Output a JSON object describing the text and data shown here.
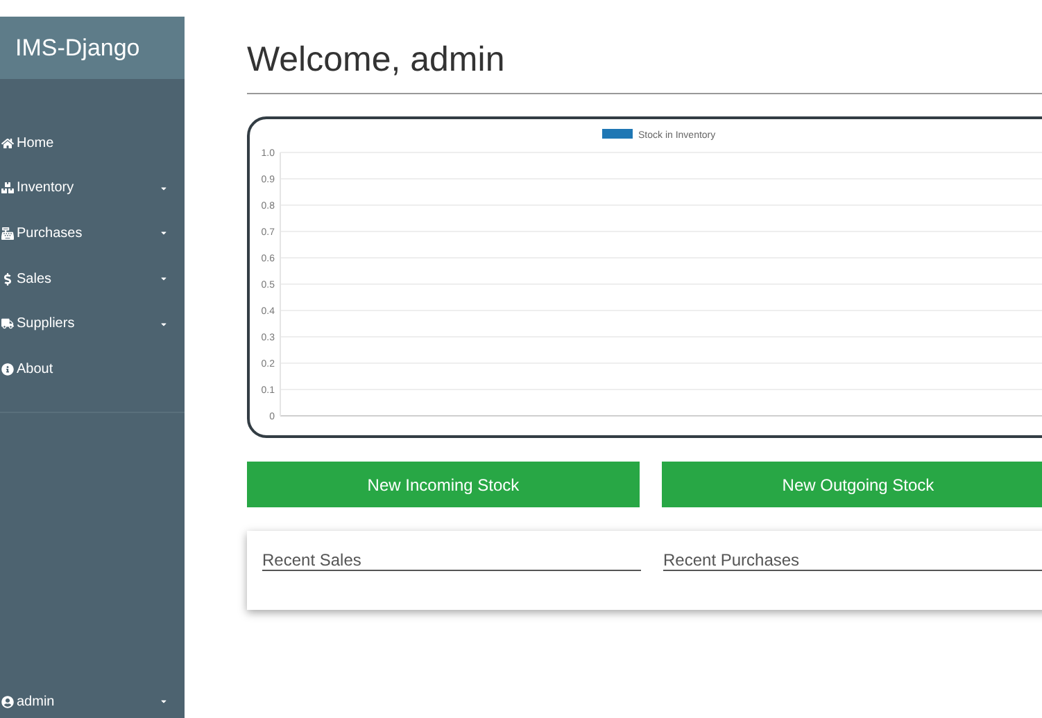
{
  "sidebar": {
    "brand": "IMS-Django",
    "items": [
      {
        "label": "Home",
        "dropdown": false
      },
      {
        "label": "Inventory",
        "dropdown": true
      },
      {
        "label": "Purchases",
        "dropdown": true
      },
      {
        "label": "Sales",
        "dropdown": true
      },
      {
        "label": "Suppliers",
        "dropdown": true
      },
      {
        "label": "About",
        "dropdown": false
      }
    ],
    "user": {
      "label": "admin",
      "dropdown": true
    }
  },
  "main": {
    "title": "Welcome, admin",
    "chart": {
      "chart_data": {
        "type": "bar",
        "grid": true,
        "series": [
          {
            "name": "Stock in Inventory",
            "color": "#1f77b4"
          }
        ],
        "ylim": [
          0,
          1
        ],
        "yticks": [
          {
            "value": 0,
            "label": "0"
          },
          {
            "value": 0.1,
            "label": "0.1"
          },
          {
            "value": 0.2,
            "label": "0.2"
          },
          {
            "value": 0.3,
            "label": "0.3"
          },
          {
            "value": 0.4,
            "label": "0.4"
          },
          {
            "value": 0.5,
            "label": "0.5"
          },
          {
            "value": 0.6,
            "label": "0.6"
          },
          {
            "value": 0.7,
            "label": "0.7"
          },
          {
            "value": 0.8,
            "label": "0.8"
          },
          {
            "value": 0.9,
            "label": "0.9"
          },
          {
            "value": 1,
            "label": "1.0"
          }
        ]
      }
    },
    "buttons": [
      "New Incoming Stock",
      "New Outgoing Stock"
    ],
    "panels": [
      "Recent Sales",
      "Recent Purchases"
    ]
  }
}
